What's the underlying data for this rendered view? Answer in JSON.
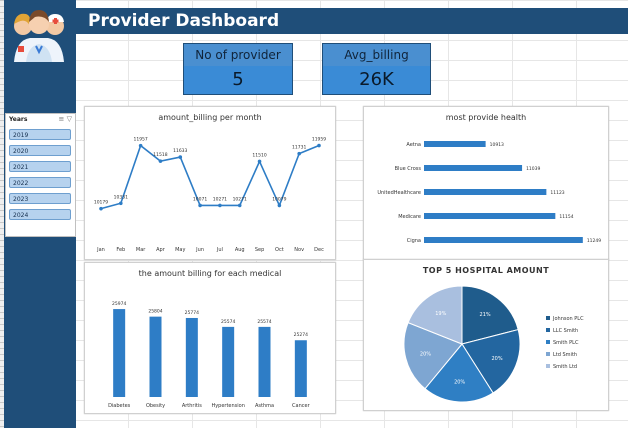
{
  "header": {
    "title": "Provider Dashboard"
  },
  "kpis": [
    {
      "label": "No of provider",
      "value": "5"
    },
    {
      "label": "Avg_billing",
      "value": "26K"
    }
  ],
  "slicer": {
    "title": "Years",
    "items": [
      "2019",
      "2020",
      "2021",
      "2022",
      "2023",
      "2024"
    ]
  },
  "colors": {
    "header": "#1f4e79",
    "bar": "#2e7dc6",
    "line": "#2e7dc6"
  },
  "chart_data": [
    {
      "type": "line",
      "title": "amount_billing per month",
      "categories": [
        "Jan",
        "Feb",
        "Mar",
        "Apr",
        "May",
        "Jun",
        "Jul",
        "Aug",
        "Sep",
        "Oct",
        "Nov",
        "Dec"
      ],
      "values": [
        10179,
        10331,
        11957,
        11518,
        11633,
        10271,
        10271,
        10271,
        11510,
        10271,
        11731,
        11959
      ],
      "labels": [
        "10179",
        "10331",
        "11957",
        "11518",
        "11633",
        "10071",
        "10271",
        "10271",
        "11510",
        "10079",
        "11731",
        "11959"
      ],
      "grid": false
    },
    {
      "type": "bar",
      "orientation": "horizontal",
      "title": "most provide health",
      "categories": [
        "Aetna",
        "Blue Cross",
        "UnitedHealthcare",
        "Medicare",
        "Cigna"
      ],
      "values": [
        10913,
        11039,
        11123,
        11154,
        11249
      ],
      "xlim": [
        10700,
        11260
      ]
    },
    {
      "type": "bar",
      "title": "the amount billing for each medical",
      "categories": [
        "Diabetes",
        "Obesity",
        "Arthritis",
        "Hypertension",
        "Asthma",
        "Cancer"
      ],
      "values": [
        25974,
        25804,
        25774,
        25574,
        25574,
        25274
      ],
      "labels": [
        "25974",
        "25804",
        "25774",
        "25574",
        "25574",
        "25274"
      ],
      "ylim": [
        24000,
        26200
      ]
    },
    {
      "type": "pie",
      "title": "TOP 5 HOSPITAL AMOUNT",
      "categories": [
        "Johnson PLC",
        "LLC Smith",
        "Smith PLC",
        "Ltd Smith",
        "Smith Ltd"
      ],
      "values": [
        21,
        20,
        20,
        20,
        19
      ],
      "labels": [
        "21%",
        "20%",
        "20%",
        "20%",
        "19%"
      ],
      "colors": [
        "#1f5c8c",
        "#2366a0",
        "#2f7fc4",
        "#7ea6d2",
        "#a9bfdf"
      ],
      "legend": "right"
    }
  ]
}
